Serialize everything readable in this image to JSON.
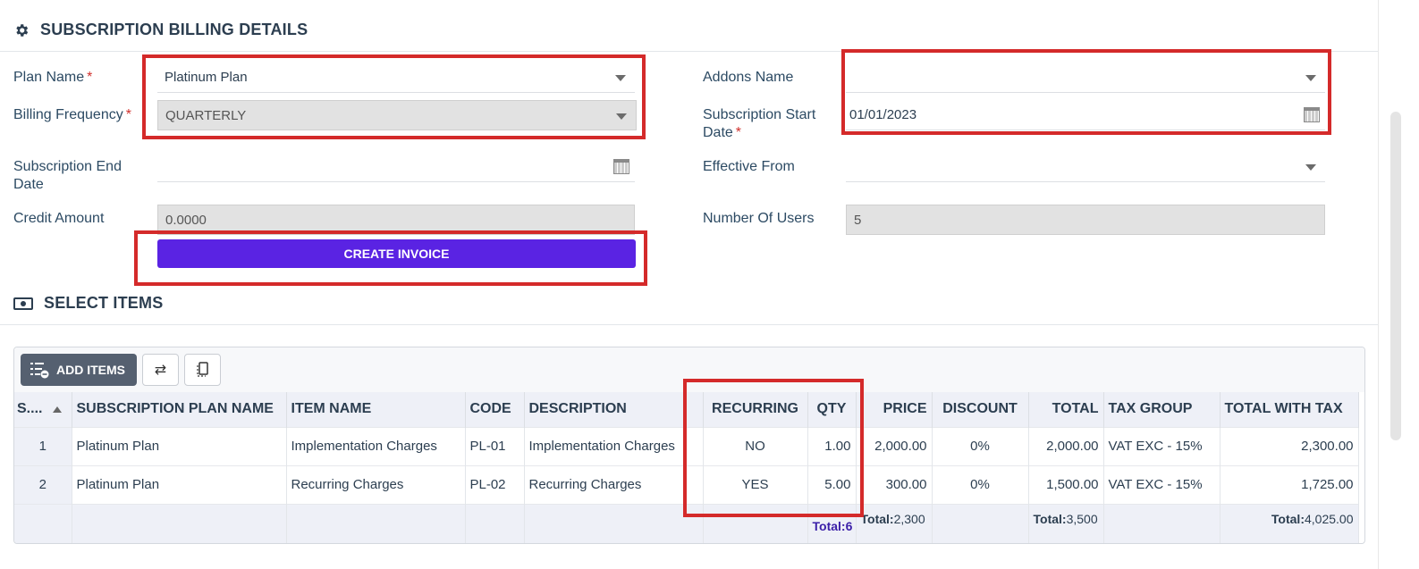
{
  "billing": {
    "section_title": "SUBSCRIPTION BILLING DETAILS",
    "plan_name_label": "Plan Name",
    "plan_name_value": "Platinum Plan",
    "billing_frequency_label": "Billing Frequency",
    "billing_frequency_value": "QUARTERLY",
    "end_date_label_1": "Subscription End",
    "end_date_label_2": "Date",
    "end_date_value": "",
    "credit_amount_label": "Credit Amount",
    "credit_amount_value": "0.0000",
    "create_invoice_label": "CREATE INVOICE",
    "addons_label": "Addons Name",
    "addons_value": "",
    "start_date_label_1": "Subscription Start",
    "start_date_label_2": "Date",
    "start_date_value": "01/01/2023",
    "effective_from_label": "Effective From",
    "effective_from_value": "",
    "users_label": "Number Of Users",
    "users_value": "5",
    "required_mark": "*"
  },
  "items": {
    "section_title": "SELECT ITEMS",
    "add_items_label": "ADD ITEMS",
    "columns": [
      "S....",
      "SUBSCRIPTION PLAN NAME",
      "ITEM NAME",
      "CODE",
      "DESCRIPTION",
      "RECURRING",
      "QTY",
      "PRICE",
      "DISCOUNT",
      "TOTAL",
      "TAX GROUP",
      "TOTAL WITH TAX"
    ],
    "rows": [
      [
        "1",
        "Platinum Plan",
        "Implementation Charges",
        "PL-01",
        "Implementation Charges",
        "NO",
        "1.00",
        "2,000.00",
        "0%",
        "2,000.00",
        "VAT EXC - 15%",
        "2,300.00"
      ],
      [
        "2",
        "Platinum Plan",
        "Recurring Charges",
        "PL-02",
        "Recurring Charges",
        "YES",
        "5.00",
        "300.00",
        "0%",
        "1,500.00",
        "VAT EXC - 15%",
        "1,725.00"
      ]
    ],
    "footer": {
      "qty_total": "Total:6",
      "price_total_label": "Total:",
      "price_total_value": "2,300",
      "total_label": "Total:",
      "total_value": "3,500",
      "total_with_tax_label": "Total:",
      "total_with_tax_value": "4,025.00"
    }
  },
  "colors": {
    "accent": "#5a23e3",
    "highlight_box": "#d42a2a",
    "required": "#d0312d"
  }
}
